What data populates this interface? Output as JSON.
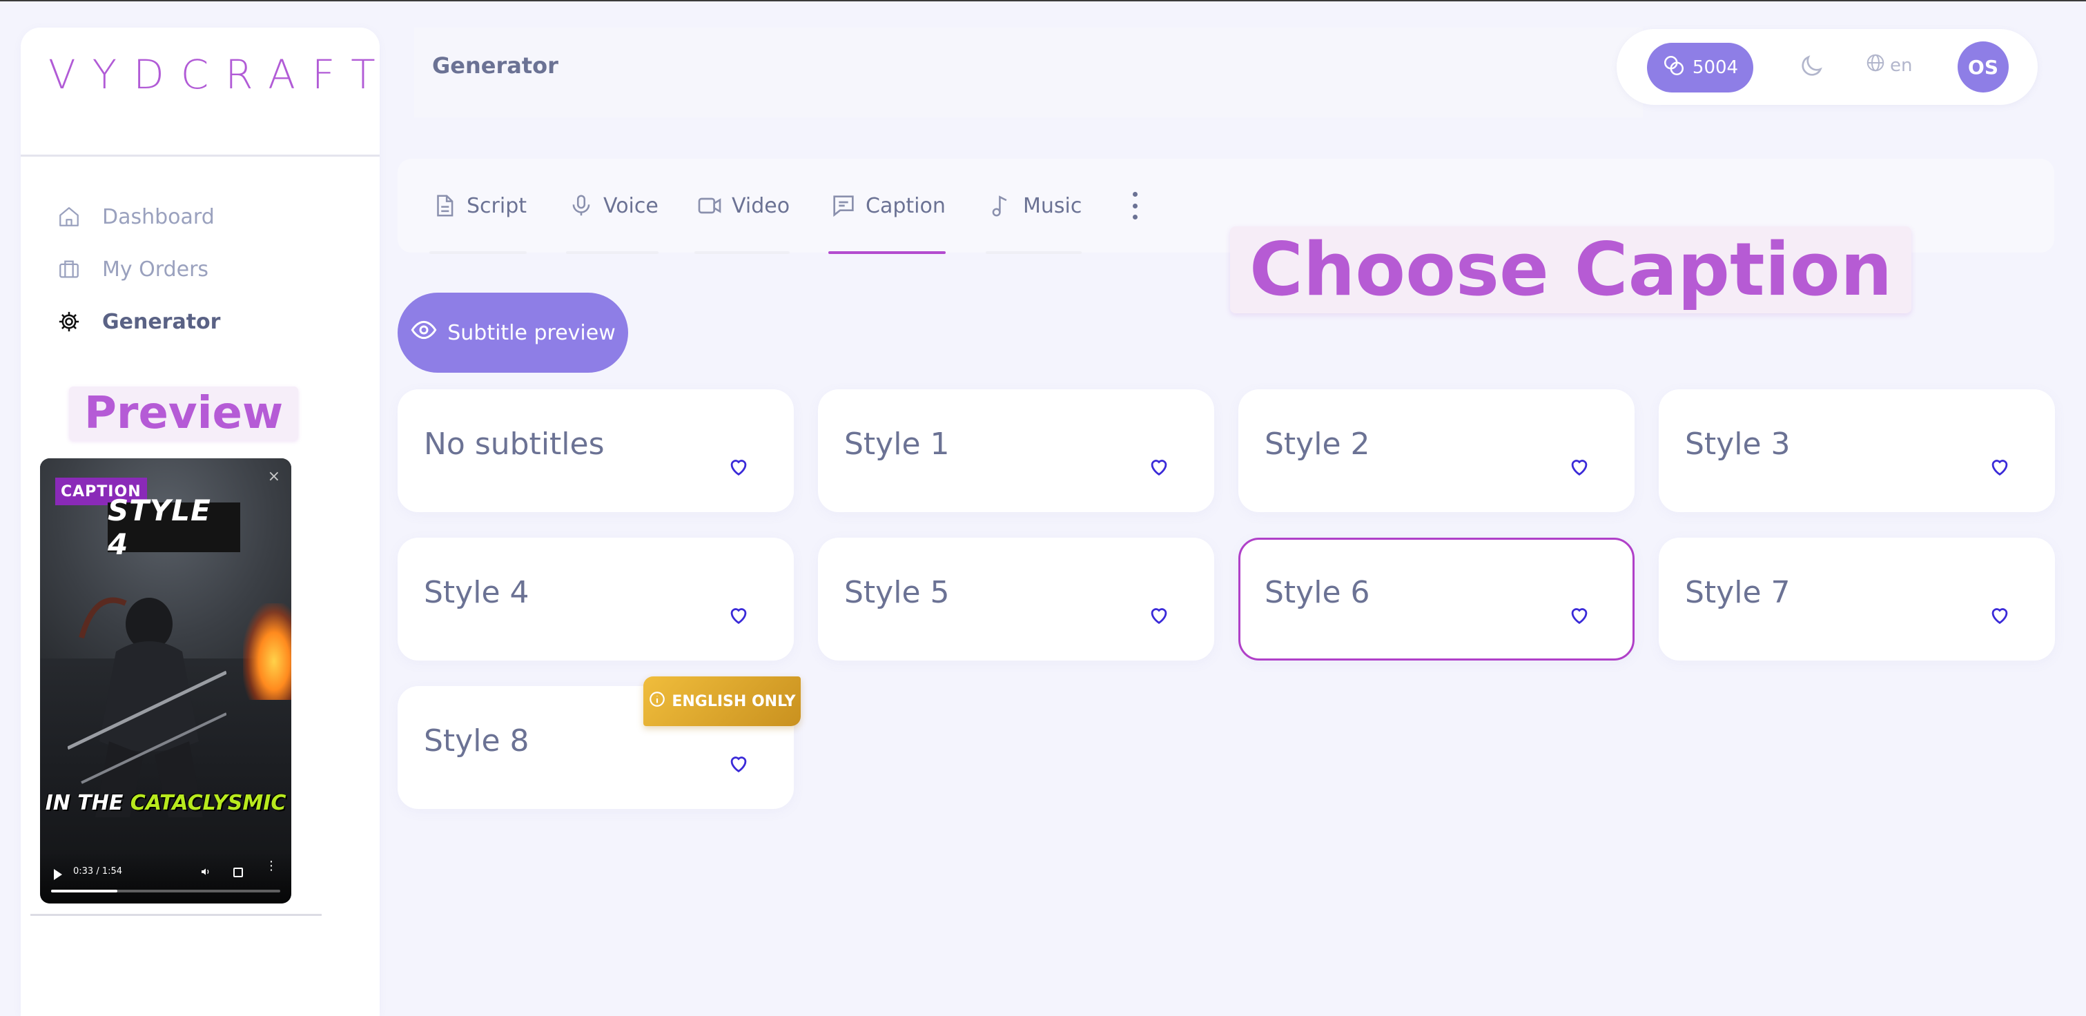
{
  "app": {
    "logo_text": "VYDCRAFT",
    "accent_color": "#8e7ee6",
    "brand_color": "#b15bd6",
    "selected_border_color": "#b040c8"
  },
  "sidebar": {
    "items": [
      {
        "label": "Dashboard",
        "icon": "home-icon",
        "active": false
      },
      {
        "label": "My Orders",
        "icon": "briefcase-icon",
        "active": false
      },
      {
        "label": "Generator",
        "icon": "gear-icon",
        "active": true
      }
    ],
    "preview_label": "Preview",
    "video": {
      "badge": "CAPTION",
      "close_symbol": "×",
      "title_overlay": "STYLE 4",
      "subtitle_plain": "IN THE ",
      "subtitle_highlight": "CATACLYSMIC",
      "time": "0:33 / 1:54",
      "progress": 0.29
    }
  },
  "header": {
    "title": "Generator",
    "credits": "5004",
    "language": "en",
    "avatar_initials": "OS"
  },
  "tabs": {
    "items": [
      {
        "label": "Script",
        "icon": "document-icon",
        "active": false
      },
      {
        "label": "Voice",
        "icon": "microphone-icon",
        "active": false
      },
      {
        "label": "Video",
        "icon": "video-camera-icon",
        "active": false
      },
      {
        "label": "Caption",
        "icon": "message-icon",
        "active": true
      },
      {
        "label": "Music",
        "icon": "music-note-icon",
        "active": false
      }
    ]
  },
  "choose_caption_label": "Choose Caption",
  "subtitle_preview_label": "Subtitle preview",
  "caption_styles": {
    "items": [
      {
        "label": "No subtitles",
        "selected": false
      },
      {
        "label": "Style 1",
        "selected": false
      },
      {
        "label": "Style 2",
        "selected": false
      },
      {
        "label": "Style 3",
        "selected": false
      },
      {
        "label": "Style 4",
        "selected": false
      },
      {
        "label": "Style 5",
        "selected": false
      },
      {
        "label": "Style 6",
        "selected": true
      },
      {
        "label": "Style 7",
        "selected": false
      },
      {
        "label": "Style 8",
        "selected": false,
        "badge": "ENGLISH ONLY"
      }
    ]
  }
}
